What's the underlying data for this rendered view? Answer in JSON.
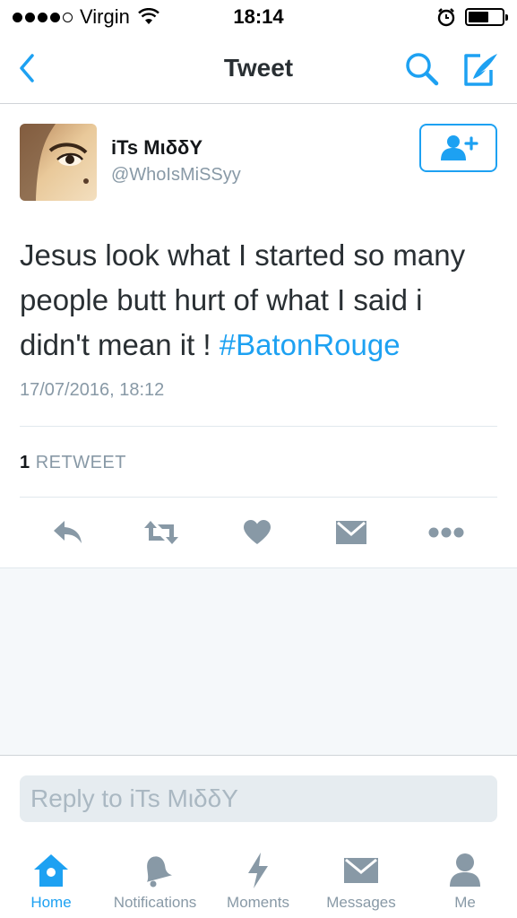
{
  "status_bar": {
    "carrier": "Virgin",
    "time": "18:14",
    "signal_dots_filled": 4,
    "battery_level": 0.6
  },
  "nav": {
    "title": "Tweet",
    "back_icon": "chevron-left-icon",
    "search_icon": "search-icon",
    "compose_icon": "compose-icon"
  },
  "tweet": {
    "author_name": "iTs MιδδY",
    "author_handle": "@WhoIsMiSSyy",
    "text": "Jesus look what I started so many people butt hurt of what I said i didn't mean it ! ",
    "hashtag": "#BatonRouge",
    "timestamp": "17/07/2016, 18:12",
    "retweet_count": "1",
    "retweet_label": "RETWEET"
  },
  "actions": [
    {
      "name": "reply",
      "icon": "reply-icon"
    },
    {
      "name": "retweet",
      "icon": "retweet-icon"
    },
    {
      "name": "like",
      "icon": "heart-icon"
    },
    {
      "name": "direct-message",
      "icon": "envelope-icon"
    },
    {
      "name": "more",
      "icon": "more-icon"
    }
  ],
  "reply": {
    "placeholder": "Reply to iTs MιδδY"
  },
  "tabs": [
    {
      "label": "Home",
      "icon": "home-icon",
      "active": true
    },
    {
      "label": "Notifications",
      "icon": "bell-icon",
      "active": false
    },
    {
      "label": "Moments",
      "icon": "lightning-icon",
      "active": false
    },
    {
      "label": "Messages",
      "icon": "envelope-icon",
      "active": false
    },
    {
      "label": "Me",
      "icon": "person-icon",
      "active": false
    }
  ],
  "colors": {
    "accent": "#1da1f2",
    "icon_gray": "#8899a6",
    "text": "#292f33"
  }
}
